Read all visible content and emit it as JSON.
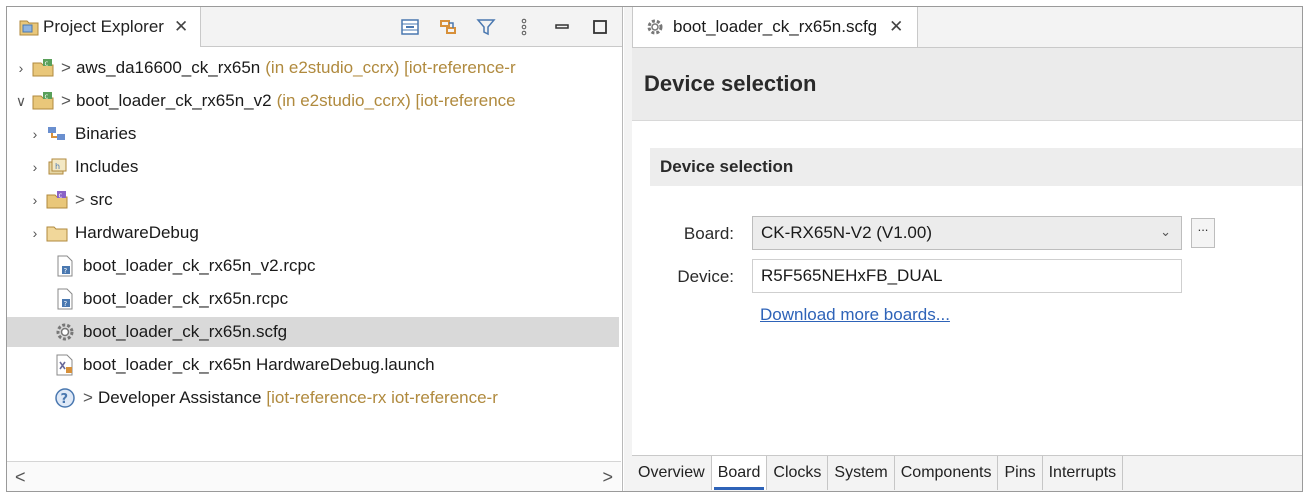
{
  "project_explorer": {
    "tab_label": "Project Explorer",
    "close_glyph": "✕",
    "tree": [
      {
        "expanded": false,
        "has_children": true,
        "indent": 0,
        "icon": "project-icon",
        "prefix": ">",
        "label": "aws_da16600_ck_rx65n",
        "decoration": "(in e2studio_ccrx) [iot-reference-r"
      },
      {
        "expanded": true,
        "has_children": true,
        "indent": 0,
        "icon": "project-icon",
        "prefix": ">",
        "label": "boot_loader_ck_rx65n_v2",
        "decoration": "(in e2studio_ccrx) [iot-reference"
      },
      {
        "expanded": false,
        "has_children": true,
        "indent": 1,
        "icon": "binaries-icon",
        "prefix": "",
        "label": "Binaries",
        "decoration": ""
      },
      {
        "expanded": false,
        "has_children": true,
        "indent": 1,
        "icon": "includes-icon",
        "prefix": "",
        "label": "Includes",
        "decoration": ""
      },
      {
        "expanded": false,
        "has_children": true,
        "indent": 1,
        "icon": "source-folder-icon",
        "prefix": ">",
        "label": "src",
        "decoration": ""
      },
      {
        "expanded": false,
        "has_children": true,
        "indent": 1,
        "icon": "folder-icon",
        "prefix": "",
        "label": "HardwareDebug",
        "decoration": ""
      },
      {
        "expanded": false,
        "has_children": false,
        "indent": 1,
        "icon": "rcpc-file-icon",
        "prefix": "",
        "label": "boot_loader_ck_rx65n_v2.rcpc",
        "decoration": ""
      },
      {
        "expanded": false,
        "has_children": false,
        "indent": 1,
        "icon": "rcpc-file-icon",
        "prefix": "",
        "label": "boot_loader_ck_rx65n.rcpc",
        "decoration": ""
      },
      {
        "expanded": false,
        "has_children": false,
        "indent": 1,
        "icon": "scfg-file-icon",
        "prefix": "",
        "label": "boot_loader_ck_rx65n.scfg",
        "decoration": "",
        "selected": true
      },
      {
        "expanded": false,
        "has_children": false,
        "indent": 1,
        "icon": "launch-file-icon",
        "prefix": "",
        "label": "boot_loader_ck_rx65n HardwareDebug.launch",
        "decoration": ""
      },
      {
        "expanded": false,
        "has_children": false,
        "indent": 1,
        "icon": "help-icon",
        "prefix": ">",
        "label": "Developer Assistance",
        "decoration": "[iot-reference-rx iot-reference-r"
      }
    ],
    "scroll_left": "<",
    "scroll_right": ">"
  },
  "editor": {
    "tab_label": "boot_loader_ck_rx65n.scfg",
    "close_glyph": "✕",
    "page_title": "Device selection",
    "section_title": "Device selection",
    "board_label": "Board:",
    "board_value": "CK-RX65N-V2 (V1.00)",
    "more_button": "...",
    "device_label": "Device:",
    "device_value": "R5F565NEHxFB_DUAL",
    "download_link": "Download more boards...",
    "bottom_tabs": [
      "Overview",
      "Board",
      "Clocks",
      "System",
      "Components",
      "Pins",
      "Interrupts"
    ],
    "active_tab": "Board"
  },
  "colors": {
    "link": "#2e63b8",
    "decoration": "#b08a3e",
    "selection": "#d9d9d9"
  }
}
